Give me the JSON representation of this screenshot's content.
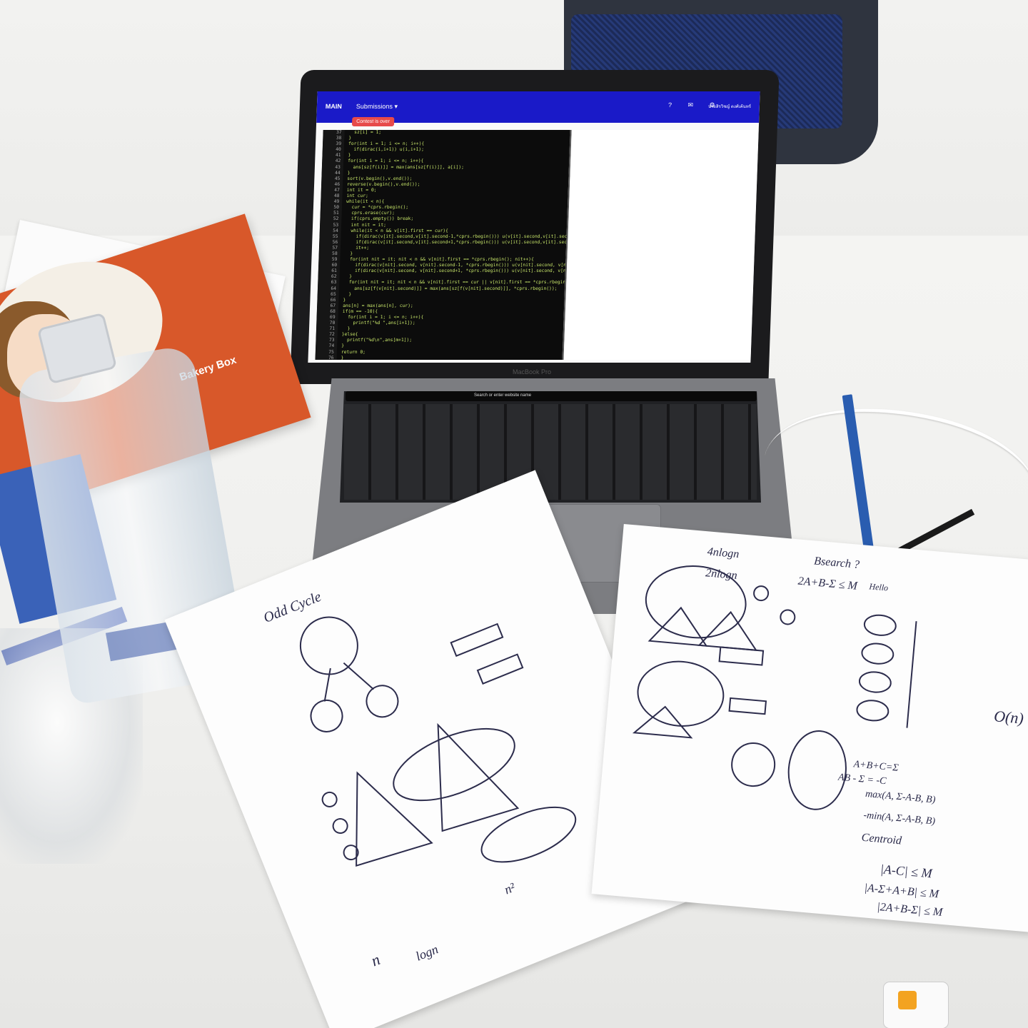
{
  "screen": {
    "brand": "MAIN",
    "menu": "Submissions ▾",
    "user": "นายสิรวิชญ์ ตงศ์เค้นทร์",
    "button": "Contest is over",
    "line_numbers": "37\n38\n39\n40\n41\n42\n43\n44\n45\n46\n47\n48\n49\n50\n51\n52\n53\n54\n55\n56\n57\n58\n59\n60\n61\n62\n63\n64\n65\n66\n67\n68\n69\n70\n71\n72\n73\n74\n75\n76\n77",
    "code": "  sz[i] = 1;\n}\nfor(int i = 1; i <= n; i++){\n  if(dirac(i,i+1)) u(i,i+1);\n}\nfor(int i = 1; i <= n; i++){\n  ans[sz[f(i)]] = max(ans[sz[f(i)]], a[i]);\n}\nsort(v.begin(),v.end());\nreverse(v.begin(),v.end());\nint it = 0;\nint cur;\nwhile(it < n){\n  cur = *cprs.rbegin();\n  cprs.erase(cur);\n  if(cprs.empty()) break;\n  int nit = it;\n  while(it < n && v[it].first == cur){\n    if(dirac(v[it].second,v[it].second-1,*cprs.rbegin())) u(v[it].second,v[it].second-1\n    if(dirac(v[it].second,v[it].second+1,*cprs.rbegin())) u(v[it].second,v[it].second+1\n    it++;\n  }\n  for(int nit = it; nit < n && v[nit].first == *cprs.rbegin(); nit++){\n    if(dirac(v[nit].second, v[nit].second-1, *cprs.rbegin())) u(v[nit].second, v[nit].s\n    if(dirac(v[nit].second, v[nit].second+1, *cprs.rbegin())) u(v[nit].second, v[nit].s\n  }\n  for(int nit = it; nit < n && v[nit].first == cur || v[nit].first == *cprs.rbegin();\n    ans[sz[f(v[nit].second)]] = max(ans[sz[f(v[nit].second)]], *cprs.rbegin());\n  }\n}\nans[n] = max(ans[n], cur);\nif(m == -10){\n  for(int i = 1; i <= n; i++){\n    printf(\"%d \",ans[i+1]);\n  }\n}else{\n  printf(\"%d\\n\",ans[m+1]);\n}\nreturn 0;\n}\n"
  },
  "laptop": {
    "model": "MacBook Pro",
    "touchbar_text": "Search or enter website name"
  },
  "box": {
    "label": "Bakery Box"
  },
  "notes": {
    "odd_cycle": "Odd Cycle",
    "bsearch": "Bsearch ?",
    "formula1": "2A+B-Σ ≤ M",
    "hello": "Hello",
    "nlogn1": "4nlogn",
    "nlogn2": "2nlogn",
    "complexity": "O(n)",
    "eq1": "A+B+C=Σ",
    "eq2": "AB - Σ = -C",
    "eq3": "max(A, Σ-A-B, B)",
    "eq4": "-min(A, Σ-A-B, B)",
    "centroid": "Centroid",
    "ineq1": "|A-C| ≤ M",
    "ineq2": "|A-Σ+A+B| ≤ M",
    "ineq3": "|2A+B-Σ| ≤ M",
    "n_left": "n",
    "logn": "logn",
    "n_sq": "n²"
  }
}
